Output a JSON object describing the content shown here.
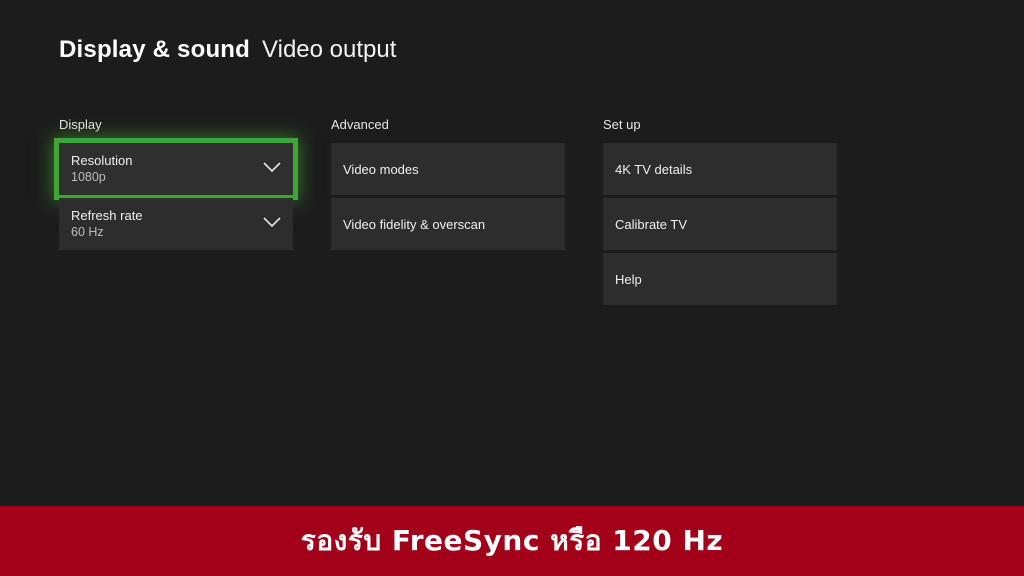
{
  "header": {
    "section": "Display & sound",
    "page": "Video output"
  },
  "display": {
    "title": "Display",
    "resolution": {
      "label": "Resolution",
      "value": "1080p"
    },
    "refresh_rate": {
      "label": "Refresh rate",
      "value": "60 Hz"
    }
  },
  "advanced": {
    "title": "Advanced",
    "items": [
      "Video modes",
      "Video fidelity & overscan"
    ]
  },
  "setup": {
    "title": "Set up",
    "items": [
      "4K TV details",
      "Calibrate TV",
      "Help"
    ]
  },
  "banner": {
    "text": "รองรับ FreeSync หรือ 120 Hz"
  },
  "colors": {
    "focus": "#3fa535",
    "banner": "#a3001a",
    "background": "#1c1c1c",
    "tile": "#2d2d2d"
  },
  "icons": {
    "dropdown": "chevron-down-icon"
  }
}
